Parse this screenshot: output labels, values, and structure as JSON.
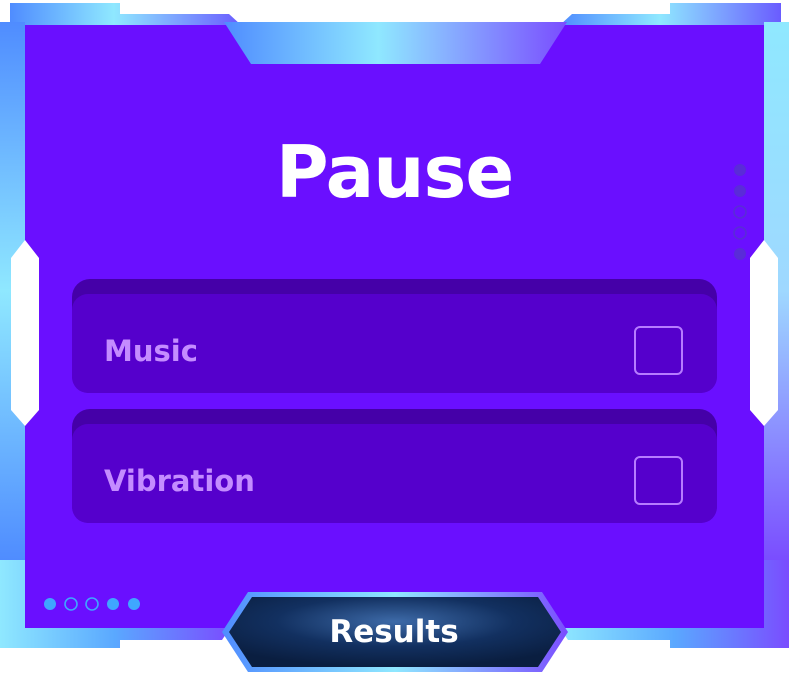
{
  "title": "Pause",
  "settings": [
    {
      "label": "Music",
      "checked": false
    },
    {
      "label": "Vibration",
      "checked": false
    }
  ],
  "button": {
    "label": "Results"
  },
  "page_indicator": {
    "dots": [
      "filled",
      "empty",
      "empty",
      "filled",
      "filled"
    ]
  },
  "side_indicator": {
    "dots": [
      "filled",
      "filled",
      "empty",
      "empty",
      "filled"
    ]
  },
  "colors": {
    "panel": "#6a0fff",
    "frame_light": "#8fe8ff",
    "frame_blue": "#4f8cff",
    "frame_violet": "#7a4dff",
    "row_face": "#5500cc",
    "row_shadow": "#4500a8",
    "label_text": "#c48cff",
    "button_bg": "#0c2448",
    "dot": "#3fa6ff"
  }
}
